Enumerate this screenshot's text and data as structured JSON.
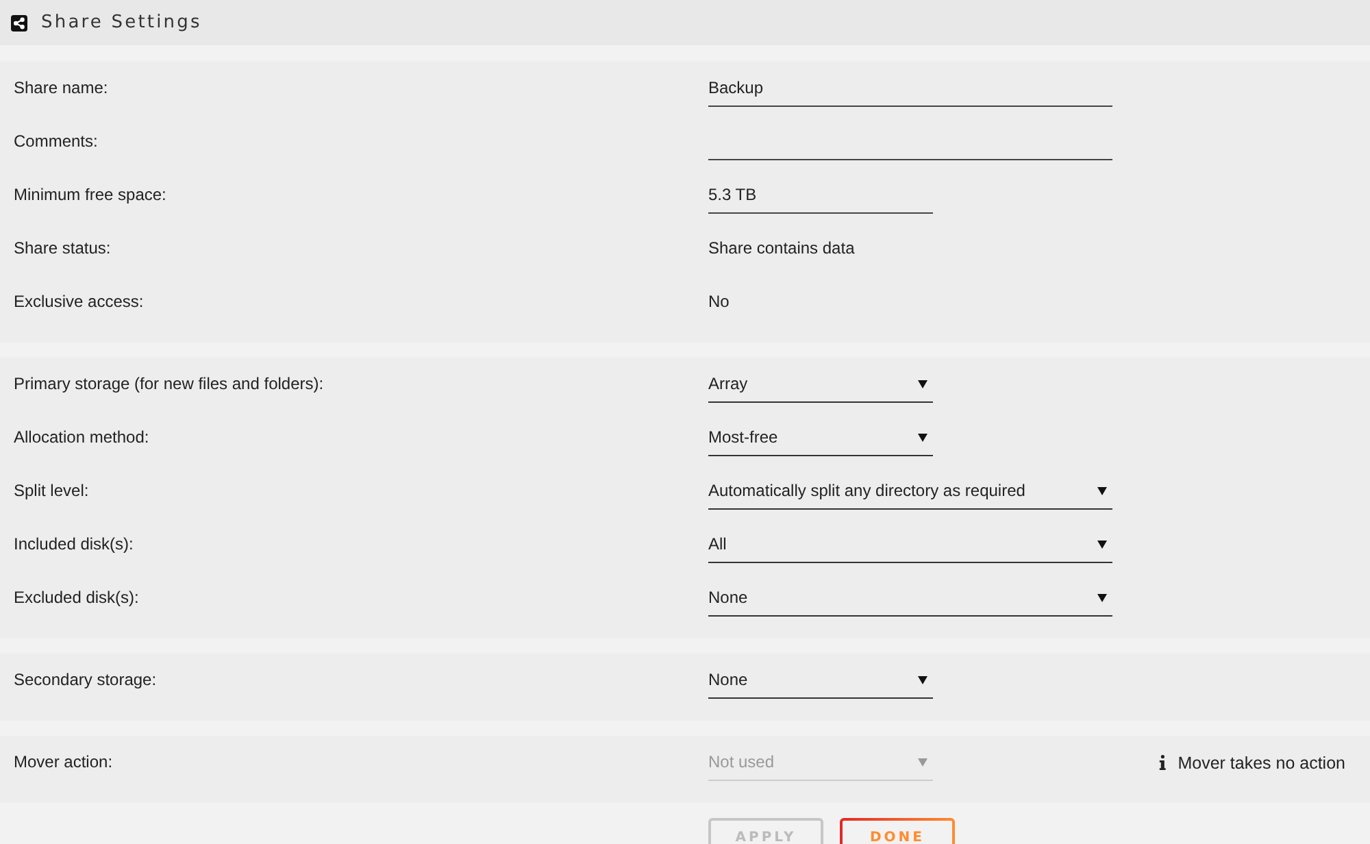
{
  "header": {
    "title": "Share Settings"
  },
  "sections": [
    {
      "rows": [
        {
          "kind": "text",
          "label": "Share name:",
          "value": "Backup"
        },
        {
          "kind": "text",
          "label": "Comments:"
        },
        {
          "kind": "text",
          "label": "Minimum free space:",
          "value": "5.3 TB"
        },
        {
          "kind": "static",
          "label": "Share status:",
          "value": "Share contains data"
        },
        {
          "kind": "static",
          "label": "Exclusive access:",
          "value": "No"
        }
      ]
    },
    {
      "rows": [
        {
          "kind": "select",
          "label": "Primary storage (for new files and folders):",
          "value": "Array",
          "disabled": false
        },
        {
          "kind": "select",
          "label": "Allocation method:",
          "value": "Most-free",
          "disabled": false
        },
        {
          "kind": "select",
          "label": "Split level:",
          "value": "Automatically split any directory as required",
          "disabled": false
        },
        {
          "kind": "select",
          "label": "Included disk(s):",
          "value": "All",
          "disabled": false
        },
        {
          "kind": "select",
          "label": "Excluded disk(s):",
          "value": "None",
          "disabled": false
        }
      ]
    },
    {
      "rows": [
        {
          "kind": "select",
          "label": "Secondary storage:",
          "value": "None",
          "disabled": false
        }
      ]
    },
    {
      "rows": [
        {
          "kind": "select",
          "label": "Mover action:",
          "value": "Not used",
          "disabled": true,
          "note": "Mover takes no action"
        }
      ]
    }
  ],
  "buttons": [
    {
      "label": "APPLY",
      "disabled": true
    },
    {
      "label": "DONE",
      "disabled": false
    }
  ]
}
